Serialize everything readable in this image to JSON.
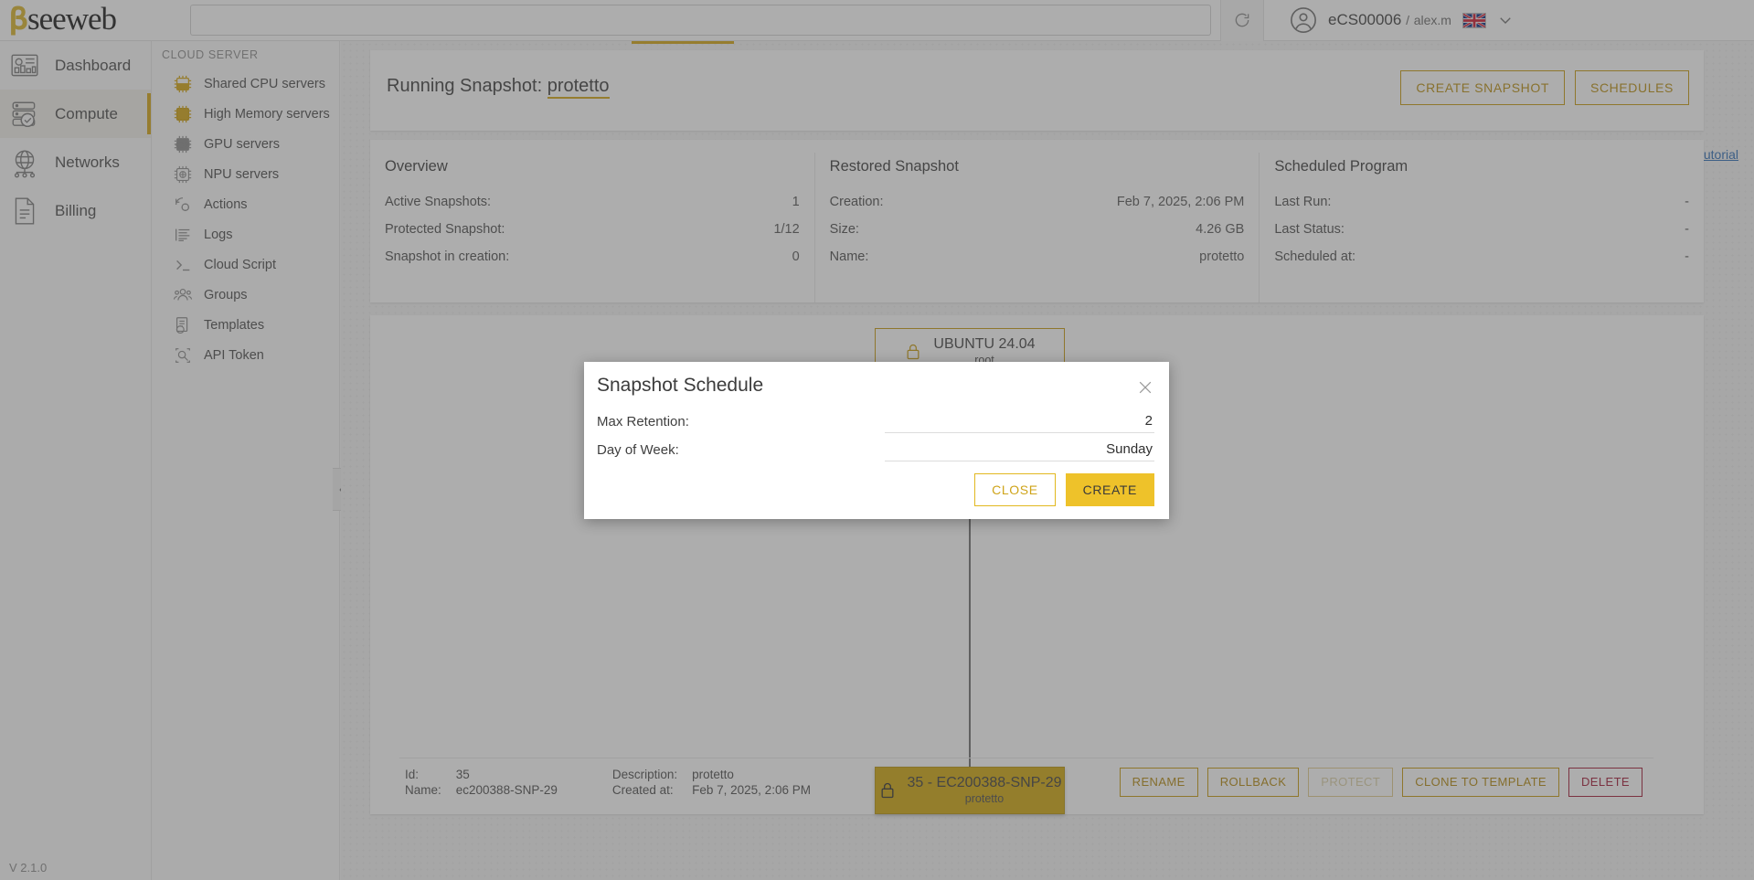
{
  "header": {
    "logo_text": "seeweb",
    "search_value": "",
    "search_placeholder": "",
    "reload_icon": "reload-icon",
    "avatar_icon": "avatar-icon",
    "account": "eCS00006",
    "separator": "/",
    "username": "alex.m",
    "language_flag": "uk-flag-icon",
    "chevron": "chevron-down-icon"
  },
  "sidebar_primary": {
    "items": [
      {
        "label": "Dashboard",
        "icon": "dashboard-icon",
        "active": false
      },
      {
        "label": "Compute",
        "icon": "server-stack-icon",
        "active": true
      },
      {
        "label": "Networks",
        "icon": "globe-network-icon",
        "active": false
      },
      {
        "label": "Billing",
        "icon": "document-icon",
        "active": false
      }
    ],
    "version": "V 2.1.0"
  },
  "sidebar_secondary": {
    "title": "CLOUD SERVER",
    "items": [
      {
        "label": "Shared CPU servers",
        "icon": "cpu-chip-icon"
      },
      {
        "label": "High Memory servers",
        "icon": "memory-chip-icon"
      },
      {
        "label": "GPU servers",
        "icon": "gpu-chip-icon"
      },
      {
        "label": "NPU servers",
        "icon": "npu-chip-icon"
      },
      {
        "label": "Actions",
        "icon": "actions-gear-icon"
      },
      {
        "label": "Logs",
        "icon": "logs-list-icon"
      },
      {
        "label": "Cloud Script",
        "icon": "terminal-icon"
      },
      {
        "label": "Groups",
        "icon": "groups-people-icon"
      },
      {
        "label": "Templates",
        "icon": "templates-icon"
      },
      {
        "label": "API Token",
        "icon": "api-token-icon"
      }
    ],
    "collapse_icon": "double-chevron-left-icon"
  },
  "main": {
    "title_prefix": "Running Snapshot:",
    "title_value": "protetto",
    "create_snapshot_label": "CREATE SNAPSHOT",
    "schedules_label": "SCHEDULES",
    "tutorial_label": "tutorial",
    "info": {
      "columns": [
        {
          "heading": "Overview",
          "rows": [
            {
              "key": "Active Snapshots:",
              "value": "1"
            },
            {
              "key": "Protected Snapshot:",
              "value": "1/12"
            },
            {
              "key": "Snapshot in creation:",
              "value": "0"
            }
          ]
        },
        {
          "heading": "Restored Snapshot",
          "rows": [
            {
              "key": "Creation:",
              "value": "Feb 7, 2025, 2:06 PM"
            },
            {
              "key": "Size:",
              "value": "4.26 GB"
            },
            {
              "key": "Name:",
              "value": "protetto"
            }
          ]
        },
        {
          "heading": "Scheduled Program",
          "rows": [
            {
              "key": "Last Run:",
              "value": "-"
            },
            {
              "key": "Last Status:",
              "value": "-"
            },
            {
              "key": "Scheduled at:",
              "value": "-"
            }
          ]
        }
      ]
    },
    "graph": {
      "root_node": {
        "title": "UBUNTU 24.04",
        "subtitle": "root",
        "icon": "lock-icon"
      },
      "snapshot_node": {
        "title": "35 - EC200388-SNP-29",
        "subtitle": "protetto",
        "icon": "lock-icon"
      }
    },
    "footer": {
      "fields": [
        {
          "key": "Id:",
          "value": "35"
        },
        {
          "key": "Name:",
          "value": "ec200388-SNP-29"
        },
        {
          "key": "Description:",
          "value": "protetto"
        },
        {
          "key": "Created at:",
          "value": "Feb 7, 2025, 2:06 PM"
        }
      ],
      "buttons": [
        {
          "label": "RENAME",
          "state": "enabled"
        },
        {
          "label": "ROLLBACK",
          "state": "enabled"
        },
        {
          "label": "PROTECT",
          "state": "disabled"
        },
        {
          "label": "CLONE TO TEMPLATE",
          "state": "enabled"
        },
        {
          "label": "DELETE",
          "state": "danger"
        }
      ]
    }
  },
  "modal": {
    "title": "Snapshot Schedule",
    "close_icon": "close-icon",
    "rows": [
      {
        "label": "Max Retention:",
        "value": "2"
      },
      {
        "label": "Day of Week:",
        "value": "Sunday"
      }
    ],
    "close_label": "CLOSE",
    "create_label": "CREATE"
  },
  "colors": {
    "brand_gold": "#d4a511",
    "solid_gold": "#eec22a",
    "danger_red": "#a01834",
    "link_blue": "#2d6cb5"
  }
}
